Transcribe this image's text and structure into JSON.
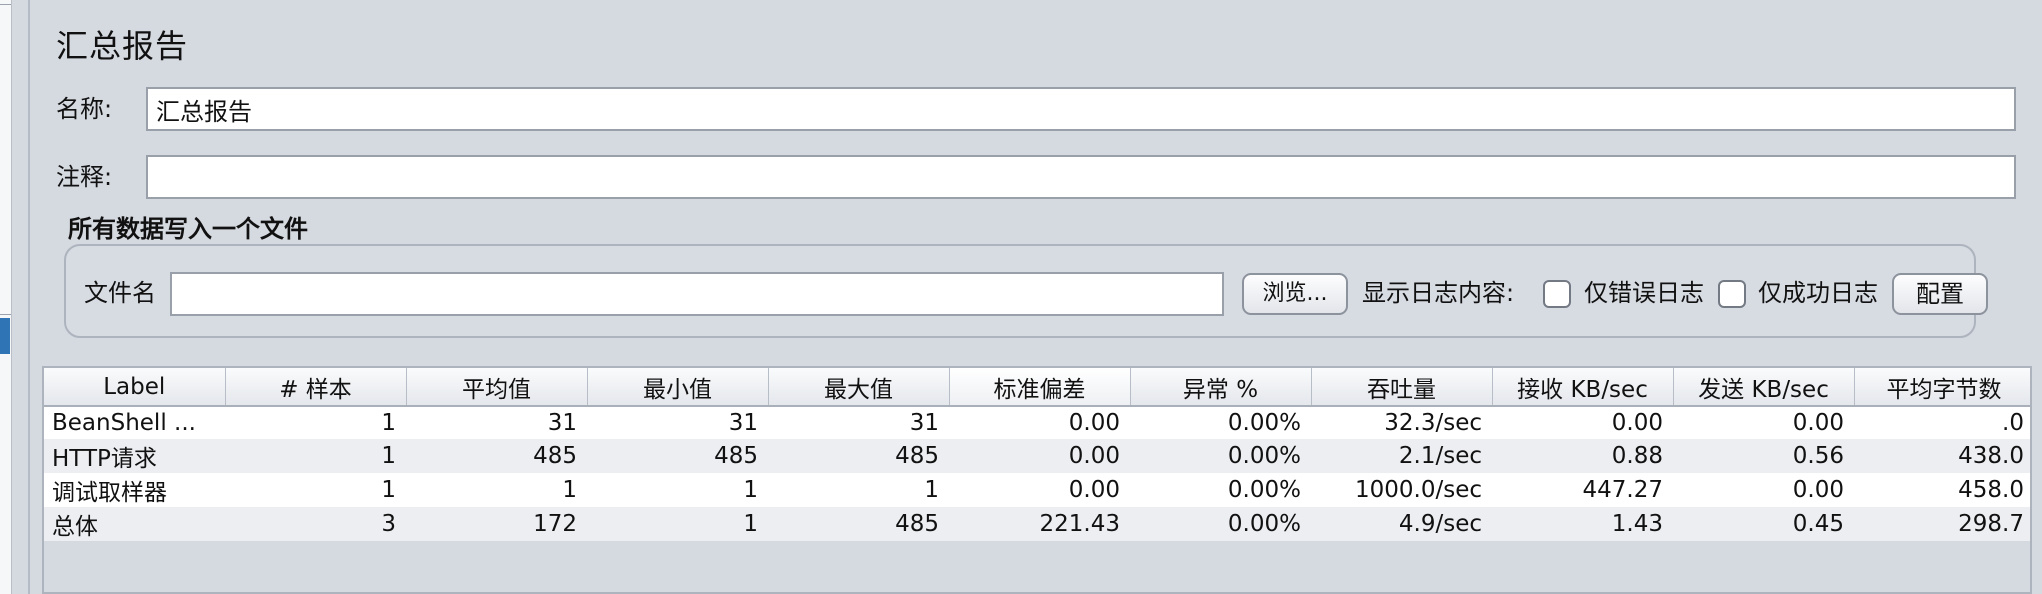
{
  "window": {
    "title": "汇总报告"
  },
  "form": {
    "name_label": "名称:",
    "name_value": "汇总报告",
    "comment_label": "注释:",
    "comment_value": ""
  },
  "file_group": {
    "title": "所有数据写入一个文件",
    "file_label": "文件名",
    "file_value": "",
    "browse_button": "浏览...",
    "log_label": "显示日志内容:",
    "errors_only_label": "仅错误日志",
    "errors_only_checked": false,
    "success_only_label": "仅成功日志",
    "success_only_checked": false,
    "config_button": "配置"
  },
  "table": {
    "columns": [
      "Label",
      "# 样本",
      "平均值",
      "最小值",
      "最大值",
      "标准偏差",
      "异常 %",
      "吞吐量",
      "接收 KB/sec",
      "发送 KB/sec",
      "平均字节数"
    ],
    "active_column": "标准偏差",
    "rows": [
      [
        "BeanShell ...",
        "1",
        "31",
        "31",
        "31",
        "0.00",
        "0.00%",
        "32.3/sec",
        "0.00",
        "0.00",
        ".0"
      ],
      [
        "HTTP请求",
        "1",
        "485",
        "485",
        "485",
        "0.00",
        "0.00%",
        "2.1/sec",
        "0.88",
        "0.56",
        "438.0"
      ],
      [
        "调试取样器",
        "1",
        "1",
        "1",
        "1",
        "0.00",
        "0.00%",
        "1000.0/sec",
        "447.27",
        "0.00",
        "458.0"
      ],
      [
        "总体",
        "3",
        "172",
        "1",
        "485",
        "221.43",
        "0.00%",
        "4.9/sec",
        "1.43",
        "0.45",
        "298.7"
      ]
    ]
  },
  "colors": {
    "panel_background": "#d5d9e0",
    "selection_accent": "#2f74b5"
  }
}
